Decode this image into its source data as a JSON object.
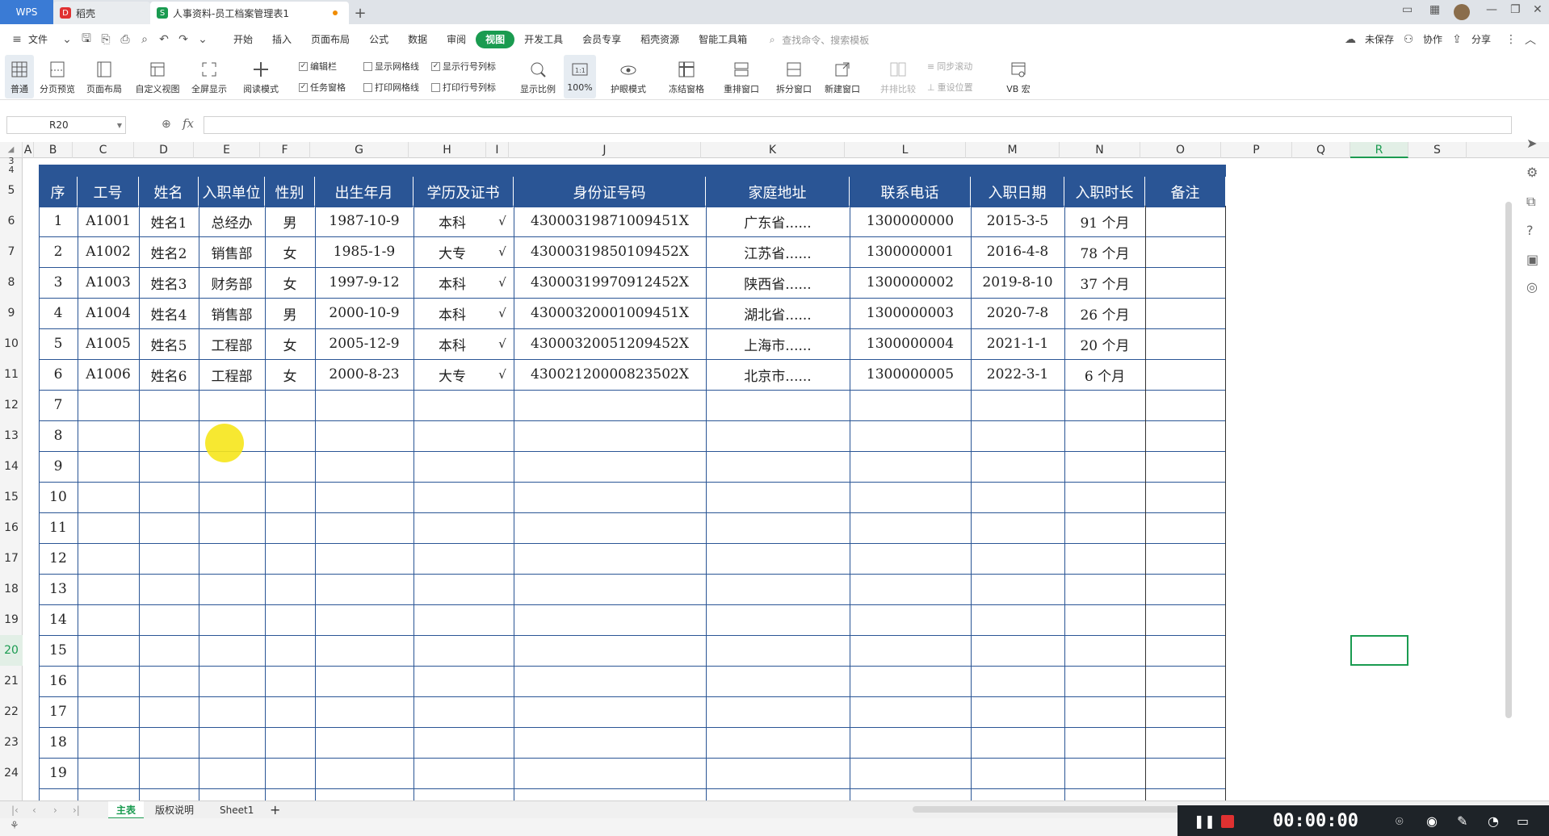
{
  "titlebar": {
    "tabs": [
      {
        "label": "WPS"
      },
      {
        "label": "稻壳"
      },
      {
        "label": "人事资料-员工档案管理表1"
      }
    ]
  },
  "menubar": {
    "file_label": "文件",
    "items": [
      "开始",
      "插入",
      "页面布局",
      "公式",
      "数据",
      "审阅",
      "视图",
      "开发工具",
      "会员专享",
      "稻壳资源",
      "智能工具箱"
    ],
    "active": "视图",
    "search_placeholder": "查找命令、搜索模板",
    "right": [
      "未保存",
      "协作",
      "分享"
    ]
  },
  "ribbon": {
    "buttons": [
      "普通",
      "分页预览",
      "页面布局",
      "自定义视图",
      "全屏显示",
      "阅读模式",
      "显示比例",
      "100%",
      "护眼模式",
      "冻结窗格",
      "重排窗口",
      "拆分窗口",
      "新建窗口",
      "并排比较",
      "VB 宏"
    ],
    "checks": [
      {
        "label": "编辑栏",
        "checked": true
      },
      {
        "label": "任务窗格",
        "checked": true
      },
      {
        "label": "显示网格线",
        "checked": false
      },
      {
        "label": "打印网格线",
        "checked": false
      },
      {
        "label": "显示行号列标",
        "checked": true
      },
      {
        "label": "打印行号列标",
        "checked": false
      }
    ],
    "dim_items": [
      "同步滚动",
      "重设位置"
    ],
    "checkmark": "✓"
  },
  "formula": {
    "namebox": "R20",
    "fx": "fx",
    "value": ""
  },
  "columns": [
    "A",
    "B",
    "C",
    "D",
    "E",
    "F",
    "G",
    "H",
    "I",
    "J",
    "K",
    "L",
    "M",
    "N",
    "O",
    "P",
    "Q",
    "R",
    "S"
  ],
  "selected_column": "R",
  "rows": [
    "3",
    "4",
    "5",
    "6",
    "7",
    "8",
    "9",
    "10",
    "11",
    "12",
    "13",
    "14",
    "15",
    "16",
    "17",
    "18",
    "19",
    "20",
    "21",
    "22",
    "23",
    "24"
  ],
  "selected_row": "20",
  "table": {
    "headers": [
      "序",
      "工号",
      "姓名",
      "入职单位",
      "性别",
      "出生年月",
      "学历及证书",
      "身份证号码",
      "家庭地址",
      "联系电话",
      "入职日期",
      "入职时长",
      "备注"
    ],
    "records": [
      [
        "1",
        "A1001",
        "姓名1",
        "总经办",
        "男",
        "1987-10-9",
        "本科",
        "√",
        "430003198710094 51X",
        "广东省......",
        "1300000000",
        "2015-3-5",
        "91 个月"
      ],
      [
        "2",
        "A1002",
        "姓名2",
        "销售部",
        "女",
        "1985-1-9",
        "大专",
        "√",
        "43000319850109452X",
        "江苏省......",
        "1300000001",
        "2016-4-8",
        "78 个月"
      ],
      [
        "3",
        "A1003",
        "姓名3",
        "财务部",
        "女",
        "1997-9-12",
        "本科",
        "√",
        "43000319970912452X",
        "陕西省......",
        "1300000002",
        "2019-8-10",
        "37 个月"
      ],
      [
        "4",
        "A1004",
        "姓名4",
        "销售部",
        "男",
        "2000-10-9",
        "本科",
        "√",
        "43000320001009451X",
        "湖北省......",
        "1300000003",
        "2020-7-8",
        "26 个月"
      ],
      [
        "5",
        "A1005",
        "姓名5",
        "工程部",
        "女",
        "2005-12-9",
        "本科",
        "√",
        "43000320051209452X",
        "上海市......",
        "1300000004",
        "2021-1-1",
        "20 个月"
      ],
      [
        "6",
        "A1006",
        "姓名6",
        "工程部",
        "女",
        "2000-8-23",
        "大专",
        "√",
        "43002120000823502X",
        "北京市......",
        "1300000005",
        "2022-3-1",
        "6 个月"
      ]
    ],
    "empty_seq": [
      "7",
      "8",
      "9",
      "10",
      "11",
      "12",
      "13",
      "14",
      "15",
      "16",
      "17",
      "18",
      "19"
    ]
  },
  "sheets": {
    "tabs": [
      "主表",
      "版权说明",
      "Sheet1"
    ],
    "active": "主表",
    "add": "+"
  },
  "recorder": {
    "time": "00:00:00"
  },
  "colors": {
    "accent": "#1a9b50",
    "header_band": "#2a5595"
  }
}
